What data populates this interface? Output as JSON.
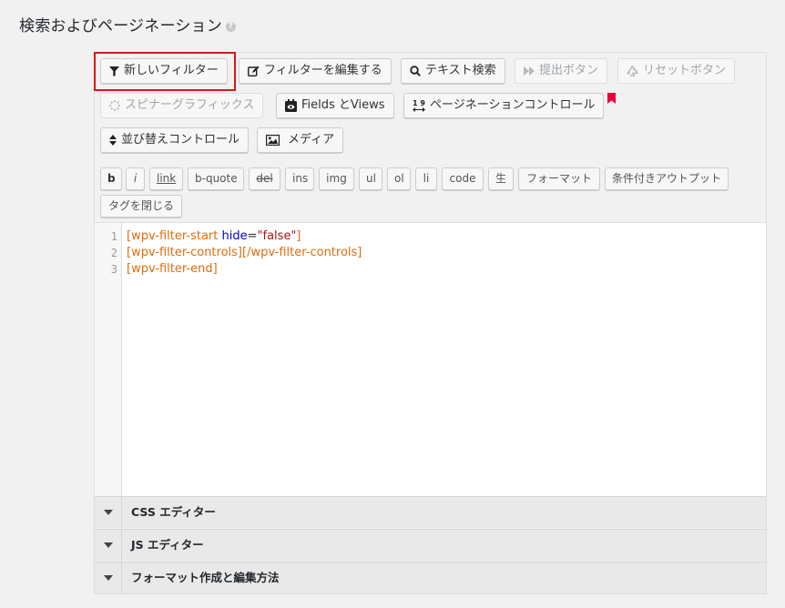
{
  "page": {
    "title": "検索およびページネーション",
    "help_icon": "?"
  },
  "toolbar": {
    "row1": [
      {
        "id": "new-filter",
        "label": "新しいフィルター",
        "icon": "filter-icon",
        "disabled": false,
        "highlighted": true
      },
      {
        "id": "edit-filter",
        "label": "フィルターを編集する",
        "icon": "edit-icon",
        "disabled": false
      },
      {
        "id": "text-search",
        "label": "テキスト検索",
        "icon": "search-icon",
        "disabled": false
      },
      {
        "id": "submit-button",
        "label": "提出ボタン",
        "icon": "fast-forward-icon",
        "disabled": true
      },
      {
        "id": "reset-button",
        "label": "リセットボタン",
        "icon": "recycle-icon",
        "disabled": true
      }
    ],
    "row2": [
      {
        "id": "spinner-graphics",
        "label": "スピナーグラフィックス",
        "icon": "spinner-icon",
        "disabled": true
      },
      {
        "id": "fields-views",
        "label": "Fields とViews",
        "icon": "views-icon",
        "disabled": false
      },
      {
        "id": "pagination-control",
        "label": "ページネーションコントロール",
        "icon": "pagination-icon",
        "icon_text": "1 9",
        "disabled": false,
        "badge": "bookmark-flag-icon"
      }
    ],
    "row3": [
      {
        "id": "sort-control",
        "label": "並び替えコントロール",
        "icon": "sort-icon",
        "disabled": false
      },
      {
        "id": "media",
        "label": "メディア",
        "icon": "image-icon",
        "disabled": false
      }
    ]
  },
  "quicktags": {
    "row1": [
      "b",
      "i",
      "link",
      "b-quote",
      "del",
      "ins",
      "img",
      "ul",
      "ol",
      "li",
      "code",
      "生",
      "フォーマット",
      "条件付きアウトプット"
    ],
    "row2": [
      "タグを閉じる"
    ]
  },
  "editor": {
    "line_numbers": [
      "1",
      "2",
      "3"
    ],
    "lines": [
      {
        "open": "[wpv-filter-start ",
        "attr": "hide",
        "eq": "=",
        "str": "\"false\"",
        "close": "]"
      },
      {
        "text": "[wpv-filter-controls][/wpv-filter-controls]"
      },
      {
        "text": "[wpv-filter-end]"
      }
    ]
  },
  "accordions": [
    {
      "label": "CSS エディター"
    },
    {
      "label": "JS エディター"
    },
    {
      "label": "フォーマット作成と編集方法"
    }
  ],
  "colors": {
    "highlight": "#d9161c",
    "shortcode": "#e06c0c",
    "attribute": "#0000cc",
    "string": "#aa1111",
    "flag": "#e8003a"
  }
}
